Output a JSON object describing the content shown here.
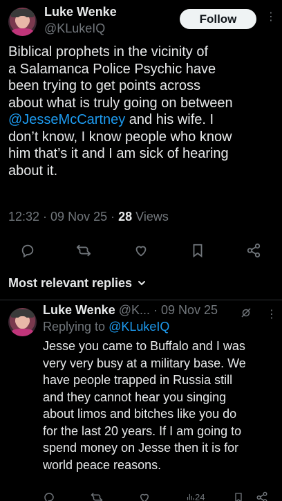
{
  "main_post": {
    "author_name": "Luke Wenke",
    "author_handle": "@KLukeIQ",
    "follow_label": "Follow",
    "body_lines": [
      "Biblical prophets in the vicinity of",
      "a Salamanca Police Psychic have",
      "been trying to get points across",
      "about what is truly going on between"
    ],
    "mention": "@JesseMcCartney",
    "body_after_mention": " and his wife.  I",
    "body_lines_2": [
      "don’t know, I know people who know",
      "him that’s it and I am sick of hearing",
      "about it."
    ],
    "time": "12:32",
    "sep1": " · ",
    "date": "09 Nov 25",
    "sep2": " · ",
    "views_count": "28",
    "views_label": " Views"
  },
  "replies_sort": {
    "label": "Most relevant replies",
    "chevron": "⌄"
  },
  "reply": {
    "author_name": "Luke Wenke",
    "author_handle": "@K...",
    "sep": " · ",
    "date": "09 Nov 25",
    "replying_to_label": "Replying to ",
    "replying_to_handle": "@KLukeIQ",
    "body_lines": [
      "Jesse you came to Buffalo and I was",
      "very very busy at a military base.  We",
      "have people trapped in Russia still",
      "and they cannot hear you singing",
      "about limos and bitches like you do",
      "for the last 20 years.  If I am going to",
      "spend money on Jesse then it is for",
      "world peace reasons."
    ],
    "views_count": "24"
  },
  "colors": {
    "background": "#000000",
    "text": "#e7e9ea",
    "muted": "#71767b",
    "link": "#1d9bf0",
    "divider": "#2f3336"
  }
}
